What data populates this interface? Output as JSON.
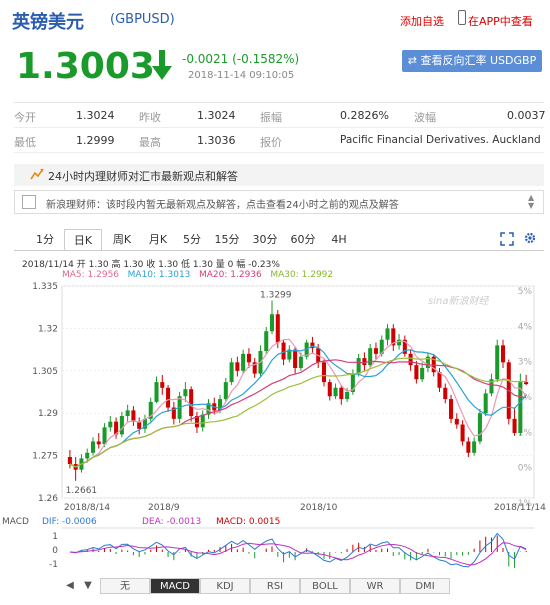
{
  "header": {
    "title": "英镑美元",
    "code": "(GBPUSD)",
    "add_watch": "添加自选",
    "app_watch": "在APP中查看",
    "price": "1.3003",
    "change": "-0.0021 (-0.1582%)",
    "time": "2018-11-14 09:10:05",
    "reverse_button": "⇄ 查看反向汇率 USDGBP",
    "colors": {
      "brand": "#2a5db0",
      "down": "#1a9a2a",
      "up": "#d00000"
    }
  },
  "quote": {
    "rows": [
      [
        {
          "label": "今开",
          "value": "1.3024"
        },
        {
          "label": "昨收",
          "value": "1.3024"
        },
        {
          "label": "振幅",
          "value": "0.2826%"
        },
        {
          "label": "波幅",
          "value": "0.0037"
        }
      ],
      [
        {
          "label": "最低",
          "value": "1.2999"
        },
        {
          "label": "最高",
          "value": "1.3036"
        },
        {
          "label": "报价",
          "value": "Pacific Financial Derivatives. Auckland"
        }
      ]
    ]
  },
  "news": {
    "bar_title": "24小时内理财师对汇市最新观点和解答",
    "notice": "新浪理财师：该时段内暂无最新观点及解答，点击查看24小时之前的观点及解答"
  },
  "tabs": [
    "1分",
    "日K",
    "周K",
    "月K",
    "5分",
    "15分",
    "30分",
    "60分",
    "4H"
  ],
  "active_tab": "日K",
  "kline_info": "2018/11/14  开 1.30  高 1.30  收 1.30  低 1.30  量 0  幅 -0.23%",
  "ma_info": {
    "ma5": "MA5: 1.2956",
    "ma10": "MA10: 1.3013",
    "ma20": "MA20: 1.2936",
    "ma30": "MA30: 1.2992"
  },
  "watermark": "sina新浪财经",
  "chart_data": {
    "type": "candlestick",
    "y_ticks": [
      "1.335",
      "1.32",
      "1.305",
      "1.29",
      "1.275",
      "1.26"
    ],
    "ylim": [
      1.26,
      1.335
    ],
    "right_ticks": [
      "5%",
      "4%",
      "3%",
      "2%",
      "1%",
      "0%",
      "-1%"
    ],
    "x_ticks": [
      "2018/8/14",
      "2018/9",
      "2018/10",
      "2018/11/14"
    ],
    "annotations": {
      "high": "1.3299",
      "low": "1.2661"
    },
    "candles": [
      [
        1.2745,
        1.272,
        1.277,
        1.2705
      ],
      [
        1.272,
        1.27,
        1.2745,
        1.2661
      ],
      [
        1.27,
        1.274,
        1.2755,
        1.269
      ],
      [
        1.274,
        1.276,
        1.2775,
        1.2725
      ],
      [
        1.276,
        1.28,
        1.2815,
        1.275
      ],
      [
        1.28,
        1.279,
        1.283,
        1.2775
      ],
      [
        1.279,
        1.285,
        1.2865,
        1.278
      ],
      [
        1.285,
        1.287,
        1.289,
        1.2835
      ],
      [
        1.287,
        1.2825,
        1.2885,
        1.281
      ],
      [
        1.2825,
        1.289,
        1.2905,
        1.2815
      ],
      [
        1.289,
        1.291,
        1.293,
        1.287
      ],
      [
        1.291,
        1.287,
        1.2925,
        1.2855
      ],
      [
        1.287,
        1.2845,
        1.2885,
        1.2825
      ],
      [
        1.2845,
        1.288,
        1.2895,
        1.283
      ],
      [
        1.288,
        1.294,
        1.2955,
        1.287
      ],
      [
        1.294,
        1.301,
        1.303,
        1.2935
      ],
      [
        1.301,
        1.299,
        1.3035,
        1.2965
      ],
      [
        1.299,
        1.292,
        1.3,
        1.2905
      ],
      [
        1.292,
        1.288,
        1.294,
        1.286
      ],
      [
        1.288,
        1.296,
        1.2975,
        1.2865
      ],
      [
        1.296,
        1.2985,
        1.301,
        1.294
      ],
      [
        1.2985,
        1.289,
        1.2995,
        1.287
      ],
      [
        1.289,
        1.285,
        1.2905,
        1.283
      ],
      [
        1.285,
        1.2895,
        1.291,
        1.2835
      ],
      [
        1.2895,
        1.2935,
        1.295,
        1.288
      ],
      [
        1.2935,
        1.291,
        1.2955,
        1.2895
      ],
      [
        1.291,
        1.295,
        1.2965,
        1.29
      ],
      [
        1.295,
        1.301,
        1.3025,
        1.294
      ],
      [
        1.301,
        1.308,
        1.3095,
        1.3
      ],
      [
        1.308,
        1.305,
        1.31,
        1.303
      ],
      [
        1.305,
        1.311,
        1.3125,
        1.304
      ],
      [
        1.311,
        1.308,
        1.313,
        1.306
      ],
      [
        1.308,
        1.304,
        1.3095,
        1.3025
      ],
      [
        1.304,
        1.312,
        1.314,
        1.303
      ],
      [
        1.312,
        1.319,
        1.3205,
        1.311
      ],
      [
        1.319,
        1.325,
        1.3299,
        1.318
      ],
      [
        1.325,
        1.315,
        1.3265,
        1.313
      ],
      [
        1.315,
        1.309,
        1.316,
        1.307
      ],
      [
        1.309,
        1.3125,
        1.314,
        1.308
      ],
      [
        1.3125,
        1.306,
        1.3135,
        1.304
      ],
      [
        1.306,
        1.31,
        1.3115,
        1.305
      ],
      [
        1.31,
        1.315,
        1.316,
        1.309
      ],
      [
        1.315,
        1.313,
        1.317,
        1.311
      ],
      [
        1.313,
        1.308,
        1.3145,
        1.306
      ],
      [
        1.308,
        1.301,
        1.309,
        1.2995
      ],
      [
        1.301,
        1.296,
        1.302,
        1.2945
      ],
      [
        1.296,
        1.299,
        1.3005,
        1.295
      ],
      [
        1.299,
        1.295,
        1.3,
        1.293
      ],
      [
        1.295,
        1.2975,
        1.299,
        1.294
      ],
      [
        1.2975,
        1.304,
        1.3055,
        1.2965
      ],
      [
        1.304,
        1.3095,
        1.311,
        1.303
      ],
      [
        1.3095,
        1.307,
        1.3115,
        1.305
      ],
      [
        1.307,
        1.313,
        1.3145,
        1.306
      ],
      [
        1.313,
        1.311,
        1.315,
        1.309
      ],
      [
        1.311,
        1.316,
        1.3175,
        1.31
      ],
      [
        1.316,
        1.32,
        1.3215,
        1.314
      ],
      [
        1.32,
        1.314,
        1.3215,
        1.312
      ],
      [
        1.314,
        1.316,
        1.318,
        1.3125
      ],
      [
        1.316,
        1.311,
        1.3175,
        1.31
      ],
      [
        1.311,
        1.307,
        1.3125,
        1.305
      ],
      [
        1.307,
        1.302,
        1.3085,
        1.3005
      ],
      [
        1.302,
        1.306,
        1.308,
        1.301
      ],
      [
        1.306,
        1.31,
        1.3115,
        1.3045
      ],
      [
        1.31,
        1.3045,
        1.311,
        1.303
      ],
      [
        1.3045,
        1.299,
        1.306,
        1.2975
      ],
      [
        1.299,
        1.295,
        1.3005,
        1.2935
      ],
      [
        1.295,
        1.288,
        1.2965,
        1.2865
      ],
      [
        1.288,
        1.286,
        1.29,
        1.2845
      ],
      [
        1.286,
        1.28,
        1.2875,
        1.2785
      ],
      [
        1.28,
        1.276,
        1.2815,
        1.2745
      ],
      [
        1.276,
        1.28,
        1.2815,
        1.275
      ],
      [
        1.28,
        1.29,
        1.2915,
        1.279
      ],
      [
        1.29,
        1.297,
        1.2985,
        1.289
      ],
      [
        1.297,
        1.302,
        1.304,
        1.296
      ],
      [
        1.302,
        1.314,
        1.316,
        1.301
      ],
      [
        1.314,
        1.308,
        1.316,
        1.306
      ],
      [
        1.308,
        1.288,
        1.309,
        1.286
      ],
      [
        1.288,
        1.283,
        1.292,
        1.282
      ],
      [
        1.283,
        1.301,
        1.304,
        1.282
      ],
      [
        1.301,
        1.3003,
        1.3036,
        1.2999
      ]
    ],
    "macd": {
      "labels": {
        "dif": "DIF: -0.0006",
        "dea": "DEA: -0.0013",
        "macd": "MACD: 0.0015",
        "prefix": "MACD"
      },
      "y_ticks": [
        "1",
        "0",
        "-1"
      ]
    }
  },
  "indicator_tabs": [
    "无",
    "MACD",
    "KDJ",
    "RSI",
    "BOLL",
    "WR",
    "DMI"
  ],
  "active_indicator": "MACD",
  "scroll_arrows": {
    "up": "▲",
    "down": "▼"
  }
}
